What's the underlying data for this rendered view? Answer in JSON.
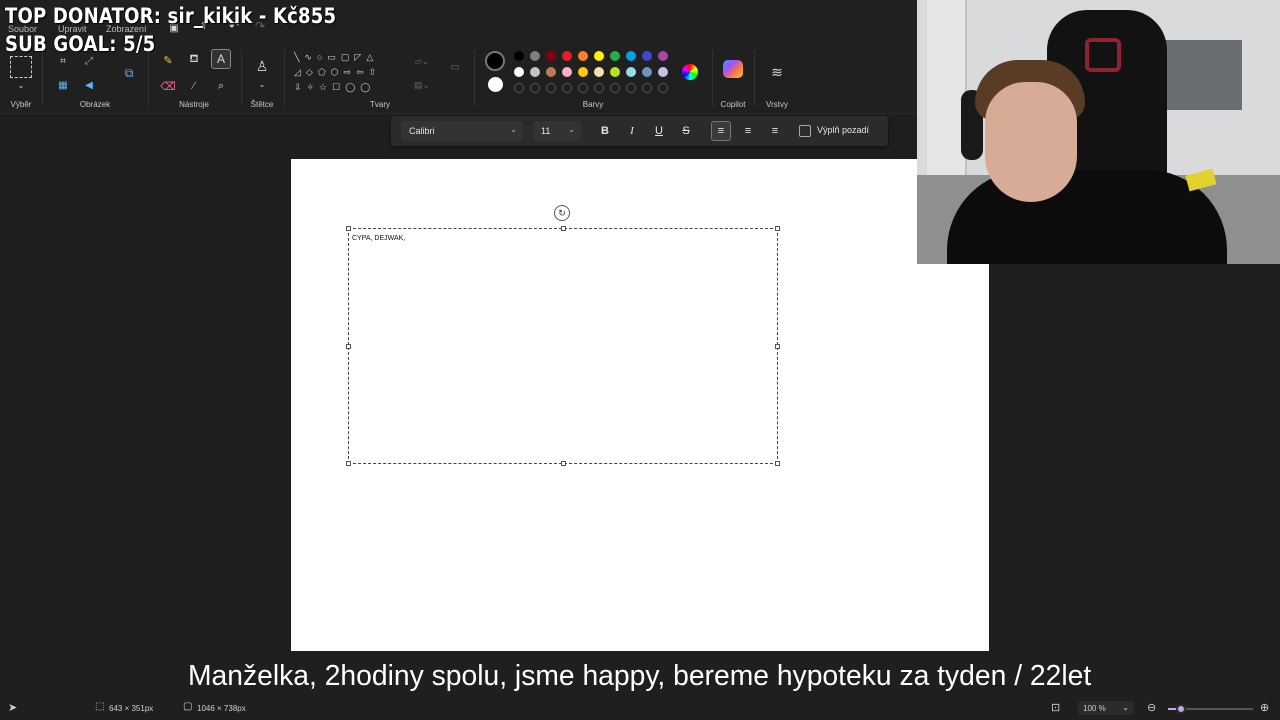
{
  "overlay": {
    "top_donator": "TOP DONATOR: sir_kikik - Kč855",
    "sub_goal": "SUB GOAL: 5/5"
  },
  "menu": {
    "items": [
      "Soubor",
      "Upravit",
      "Zobrazení"
    ]
  },
  "ribbon": {
    "groups": {
      "selection": "Výběr",
      "image": "Obrázek",
      "tools": "Nástroje",
      "brushes": "Štětce",
      "shapes": "Tvary",
      "colors": "Barvy",
      "copilot": "Copilot",
      "layers": "Vrstvy"
    },
    "palette_row1": [
      "#000000",
      "#7f7f7f",
      "#880015",
      "#ed1c24",
      "#ff7f27",
      "#fff200",
      "#22b14c",
      "#00a2e8",
      "#3f48cc",
      "#a349a4"
    ],
    "palette_row2": [
      "#ffffff",
      "#c3c3c3",
      "#b97a57",
      "#ffaec9",
      "#ffc90e",
      "#efe4b0",
      "#b5e61d",
      "#99d9ea",
      "#7092be",
      "#c8bfe7"
    ],
    "primary_color": "#000000",
    "secondary_color": "#ffffff"
  },
  "textbar": {
    "font": "Calibri",
    "size": "11",
    "bold": "B",
    "italic": "I",
    "underline": "U",
    "strike": "S",
    "fill_background": "Výplň pozadí",
    "align_active": "left"
  },
  "canvas": {
    "text_content": "CYPA, DEJWAK,"
  },
  "subtitle": "Manželka,  2hodiny spolu, jsme happy, bereme hypoteku za tyden / 22let",
  "status": {
    "selection_size": "643 × 351px",
    "canvas_size": "1046 × 738px",
    "zoom": "100 %",
    "zoom_level": 0.15
  }
}
